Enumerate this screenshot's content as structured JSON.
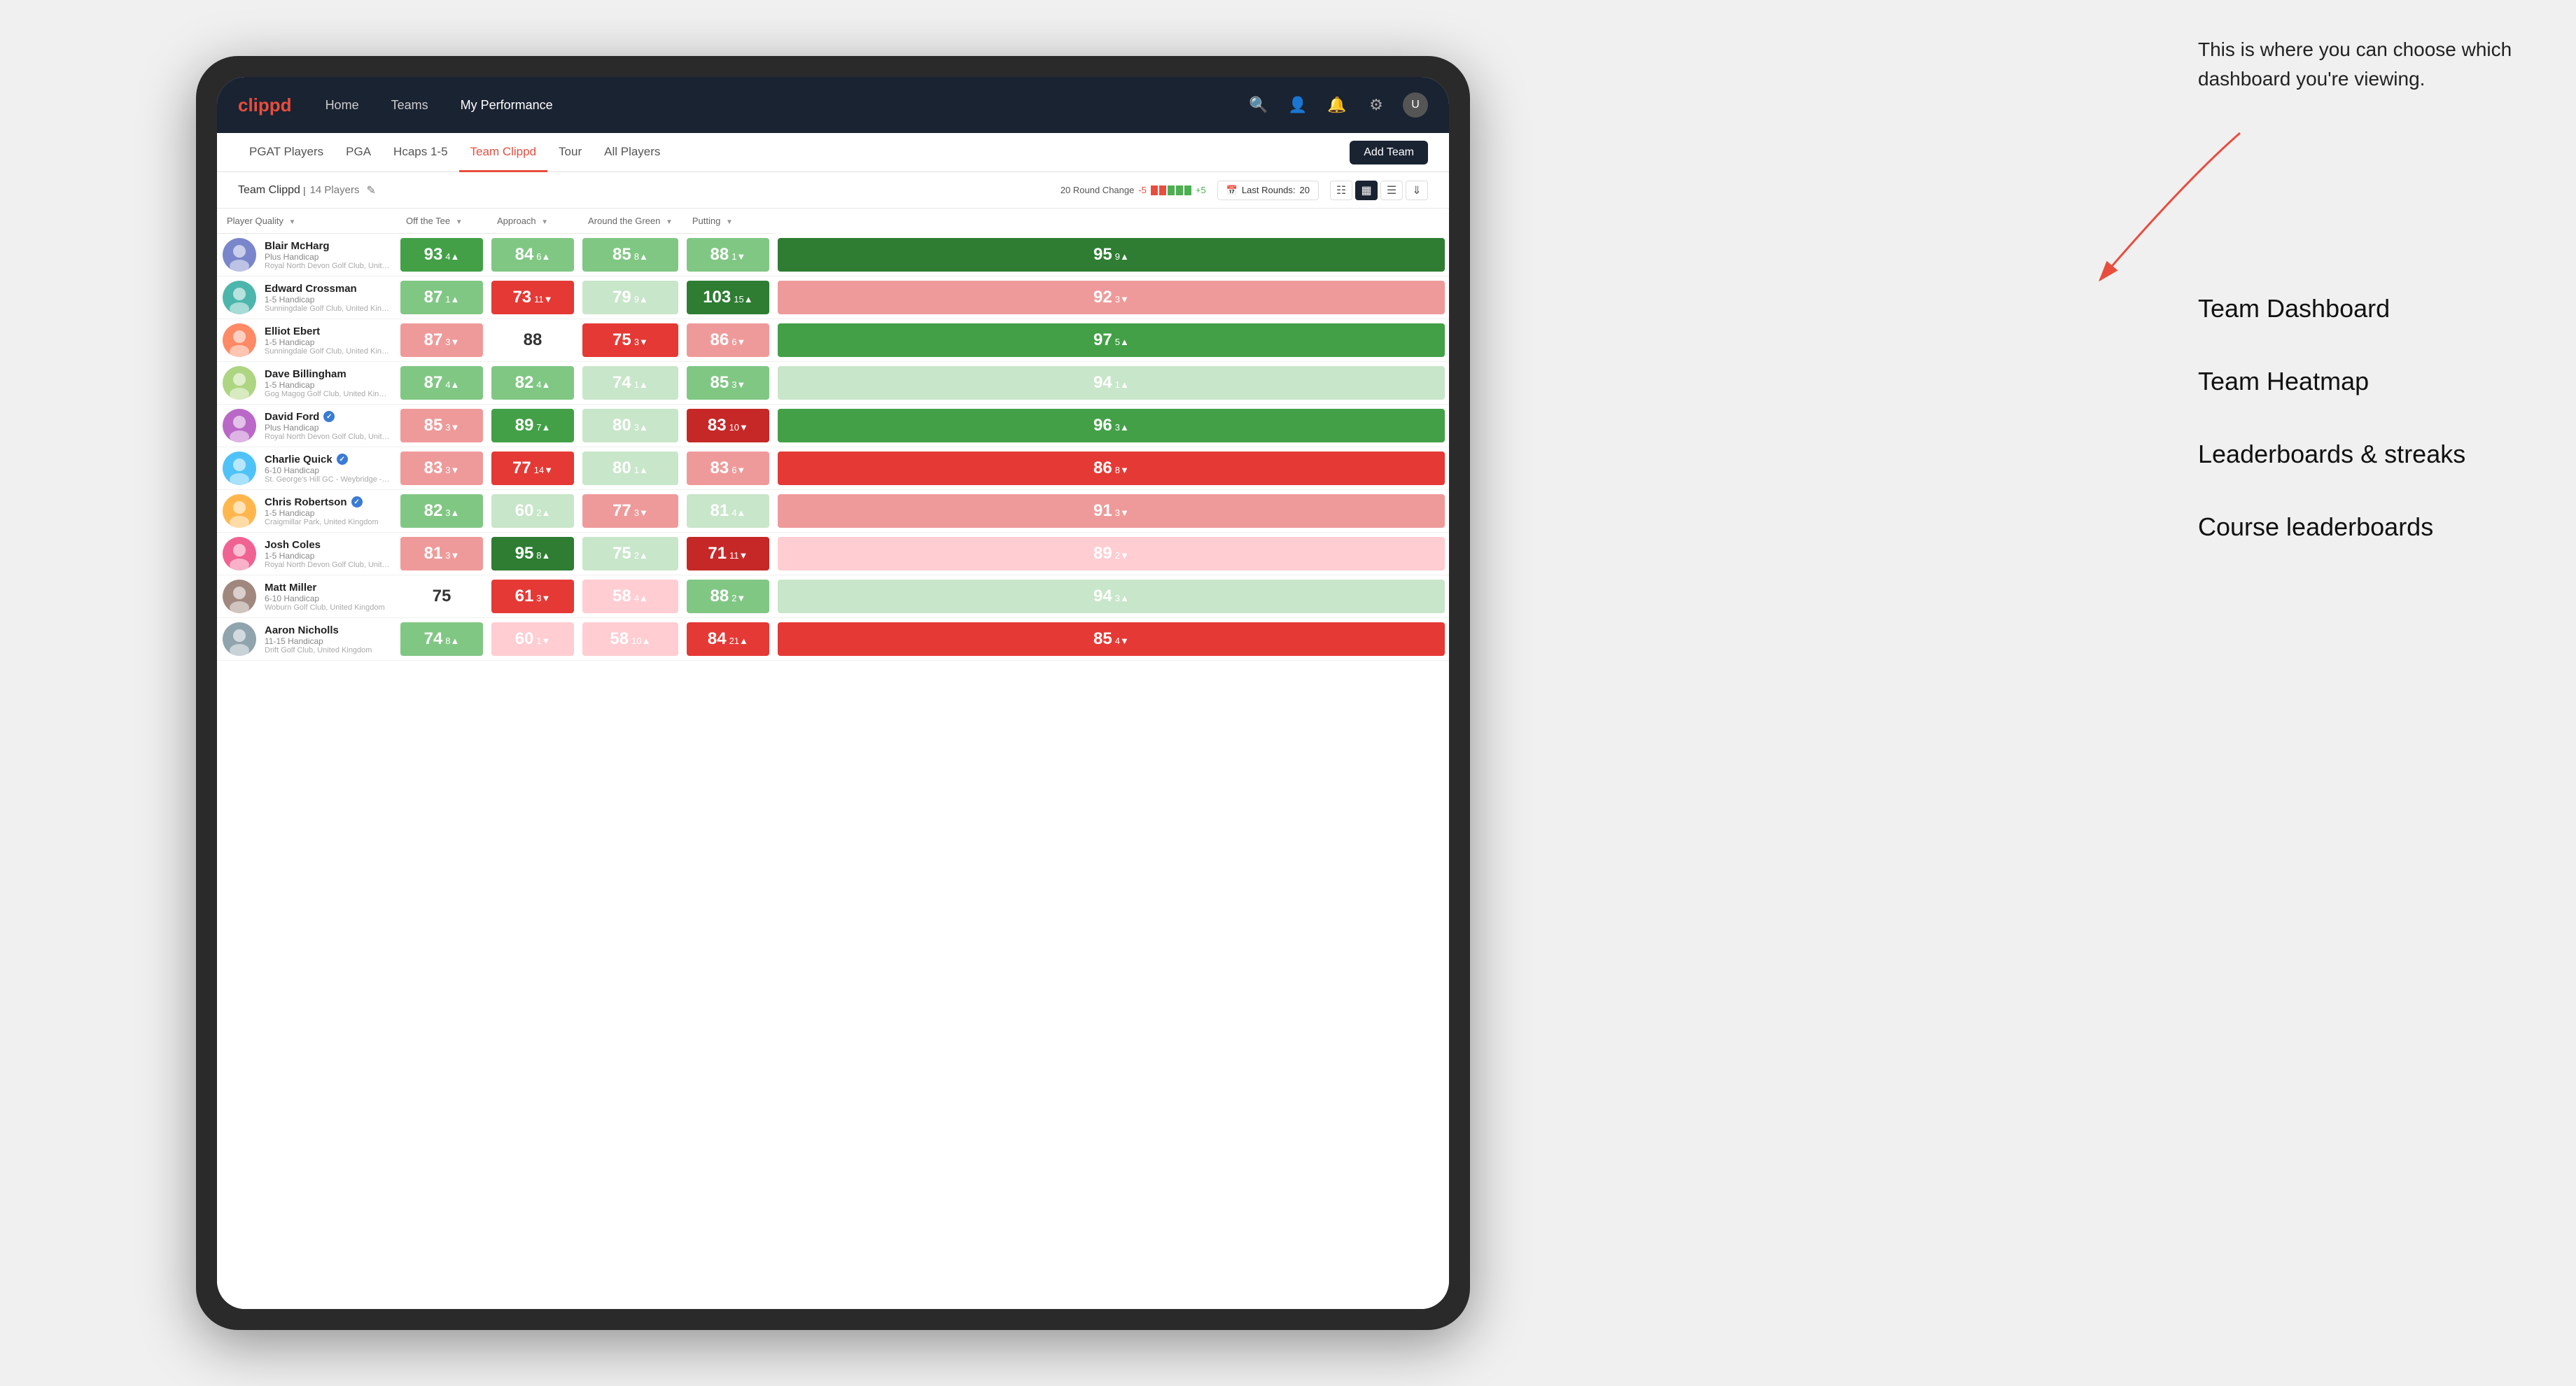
{
  "annotation": {
    "intro": "This is where you can choose which dashboard you're viewing.",
    "items": [
      "Team Dashboard",
      "Team Heatmap",
      "Leaderboards & streaks",
      "Course leaderboards"
    ]
  },
  "navbar": {
    "logo": "clippd",
    "links": [
      "Home",
      "Teams",
      "My Performance"
    ],
    "active_link": "My Performance"
  },
  "tabs": {
    "items": [
      "PGAT Players",
      "PGA",
      "Hcaps 1-5",
      "Team Clippd",
      "Tour",
      "All Players"
    ],
    "active": "Team Clippd",
    "add_button": "Add Team"
  },
  "toolbar": {
    "team_name": "Team Clippd",
    "player_count": "14 Players",
    "round_change_label": "20 Round Change",
    "change_neg": "-5",
    "change_pos": "+5",
    "last_rounds_label": "Last Rounds:",
    "last_rounds_value": "20"
  },
  "table": {
    "headers": [
      {
        "label": "Player Quality",
        "sort": true
      },
      {
        "label": "Off the Tee",
        "sort": true
      },
      {
        "label": "Approach",
        "sort": true
      },
      {
        "label": "Around the Green",
        "sort": true
      },
      {
        "label": "Putting",
        "sort": true
      }
    ],
    "players": [
      {
        "name": "Blair McHarg",
        "handicap": "Plus Handicap",
        "club": "Royal North Devon Golf Club, United Kingdom",
        "badge": false,
        "avatar_color": "av1",
        "scores": [
          {
            "val": 93,
            "change": 4,
            "dir": "up",
            "color": "green-mid"
          },
          {
            "val": 84,
            "change": 6,
            "dir": "up",
            "color": "green-light"
          },
          {
            "val": 85,
            "change": 8,
            "dir": "up",
            "color": "green-light"
          },
          {
            "val": 88,
            "change": 1,
            "dir": "down",
            "color": "green-light"
          },
          {
            "val": 95,
            "change": 9,
            "dir": "up",
            "color": "green-dark"
          }
        ]
      },
      {
        "name": "Edward Crossman",
        "handicap": "1-5 Handicap",
        "club": "Sunningdale Golf Club, United Kingdom",
        "badge": false,
        "avatar_color": "av2",
        "scores": [
          {
            "val": 87,
            "change": 1,
            "dir": "up",
            "color": "green-light"
          },
          {
            "val": 73,
            "change": 11,
            "dir": "down",
            "color": "red-mid"
          },
          {
            "val": 79,
            "change": 9,
            "dir": "up",
            "color": "green-pale"
          },
          {
            "val": 103,
            "change": 15,
            "dir": "up",
            "color": "green-dark"
          },
          {
            "val": 92,
            "change": 3,
            "dir": "down",
            "color": "red-light"
          }
        ]
      },
      {
        "name": "Elliot Ebert",
        "handicap": "1-5 Handicap",
        "club": "Sunningdale Golf Club, United Kingdom",
        "badge": false,
        "avatar_color": "av3",
        "scores": [
          {
            "val": 87,
            "change": 3,
            "dir": "down",
            "color": "red-light"
          },
          {
            "val": 88,
            "change": null,
            "dir": null,
            "color": "white-cell"
          },
          {
            "val": 75,
            "change": 3,
            "dir": "down",
            "color": "red-mid"
          },
          {
            "val": 86,
            "change": 6,
            "dir": "down",
            "color": "red-light"
          },
          {
            "val": 97,
            "change": 5,
            "dir": "up",
            "color": "green-mid"
          }
        ]
      },
      {
        "name": "Dave Billingham",
        "handicap": "1-5 Handicap",
        "club": "Gog Magog Golf Club, United Kingdom",
        "badge": false,
        "avatar_color": "av4",
        "scores": [
          {
            "val": 87,
            "change": 4,
            "dir": "up",
            "color": "green-light"
          },
          {
            "val": 82,
            "change": 4,
            "dir": "up",
            "color": "green-light"
          },
          {
            "val": 74,
            "change": 1,
            "dir": "up",
            "color": "green-pale"
          },
          {
            "val": 85,
            "change": 3,
            "dir": "down",
            "color": "green-light"
          },
          {
            "val": 94,
            "change": 1,
            "dir": "up",
            "color": "green-pale"
          }
        ]
      },
      {
        "name": "David Ford",
        "handicap": "Plus Handicap",
        "club": "Royal North Devon Golf Club, United Kingdom",
        "badge": true,
        "avatar_color": "av5",
        "scores": [
          {
            "val": 85,
            "change": 3,
            "dir": "down",
            "color": "red-light"
          },
          {
            "val": 89,
            "change": 7,
            "dir": "up",
            "color": "green-mid"
          },
          {
            "val": 80,
            "change": 3,
            "dir": "up",
            "color": "green-pale"
          },
          {
            "val": 83,
            "change": 10,
            "dir": "down",
            "color": "red-dark"
          },
          {
            "val": 96,
            "change": 3,
            "dir": "up",
            "color": "green-mid"
          }
        ]
      },
      {
        "name": "Charlie Quick",
        "handicap": "6-10 Handicap",
        "club": "St. George's Hill GC - Weybridge - Surrey, Uni...",
        "badge": true,
        "avatar_color": "av6",
        "scores": [
          {
            "val": 83,
            "change": 3,
            "dir": "down",
            "color": "red-light"
          },
          {
            "val": 77,
            "change": 14,
            "dir": "down",
            "color": "red-mid"
          },
          {
            "val": 80,
            "change": 1,
            "dir": "up",
            "color": "green-pale"
          },
          {
            "val": 83,
            "change": 6,
            "dir": "down",
            "color": "red-light"
          },
          {
            "val": 86,
            "change": 8,
            "dir": "down",
            "color": "red-mid"
          }
        ]
      },
      {
        "name": "Chris Robertson",
        "handicap": "1-5 Handicap",
        "club": "Craigmillar Park, United Kingdom",
        "badge": true,
        "avatar_color": "av7",
        "scores": [
          {
            "val": 82,
            "change": 3,
            "dir": "up",
            "color": "green-light"
          },
          {
            "val": 60,
            "change": 2,
            "dir": "up",
            "color": "green-pale"
          },
          {
            "val": 77,
            "change": 3,
            "dir": "down",
            "color": "red-light"
          },
          {
            "val": 81,
            "change": 4,
            "dir": "up",
            "color": "green-pale"
          },
          {
            "val": 91,
            "change": 3,
            "dir": "down",
            "color": "red-light"
          }
        ]
      },
      {
        "name": "Josh Coles",
        "handicap": "1-5 Handicap",
        "club": "Royal North Devon Golf Club, United Kingdom",
        "badge": false,
        "avatar_color": "av8",
        "scores": [
          {
            "val": 81,
            "change": 3,
            "dir": "down",
            "color": "red-light"
          },
          {
            "val": 95,
            "change": 8,
            "dir": "up",
            "color": "green-dark"
          },
          {
            "val": 75,
            "change": 2,
            "dir": "up",
            "color": "green-pale"
          },
          {
            "val": 71,
            "change": 11,
            "dir": "down",
            "color": "red-dark"
          },
          {
            "val": 89,
            "change": 2,
            "dir": "down",
            "color": "red-pale"
          }
        ]
      },
      {
        "name": "Matt Miller",
        "handicap": "6-10 Handicap",
        "club": "Woburn Golf Club, United Kingdom",
        "badge": false,
        "avatar_color": "av9",
        "scores": [
          {
            "val": 75,
            "change": null,
            "dir": null,
            "color": "white-cell"
          },
          {
            "val": 61,
            "change": 3,
            "dir": "down",
            "color": "red-mid"
          },
          {
            "val": 58,
            "change": 4,
            "dir": "up",
            "color": "red-pale"
          },
          {
            "val": 88,
            "change": 2,
            "dir": "down",
            "color": "green-light"
          },
          {
            "val": 94,
            "change": 3,
            "dir": "up",
            "color": "green-pale"
          }
        ]
      },
      {
        "name": "Aaron Nicholls",
        "handicap": "11-15 Handicap",
        "club": "Drift Golf Club, United Kingdom",
        "badge": false,
        "avatar_color": "av10",
        "scores": [
          {
            "val": 74,
            "change": 8,
            "dir": "up",
            "color": "green-light"
          },
          {
            "val": 60,
            "change": 1,
            "dir": "down",
            "color": "red-pale"
          },
          {
            "val": 58,
            "change": 10,
            "dir": "up",
            "color": "red-pale"
          },
          {
            "val": 84,
            "change": 21,
            "dir": "up",
            "color": "red-mid"
          },
          {
            "val": 85,
            "change": 4,
            "dir": "down",
            "color": "red-mid"
          }
        ]
      }
    ]
  }
}
